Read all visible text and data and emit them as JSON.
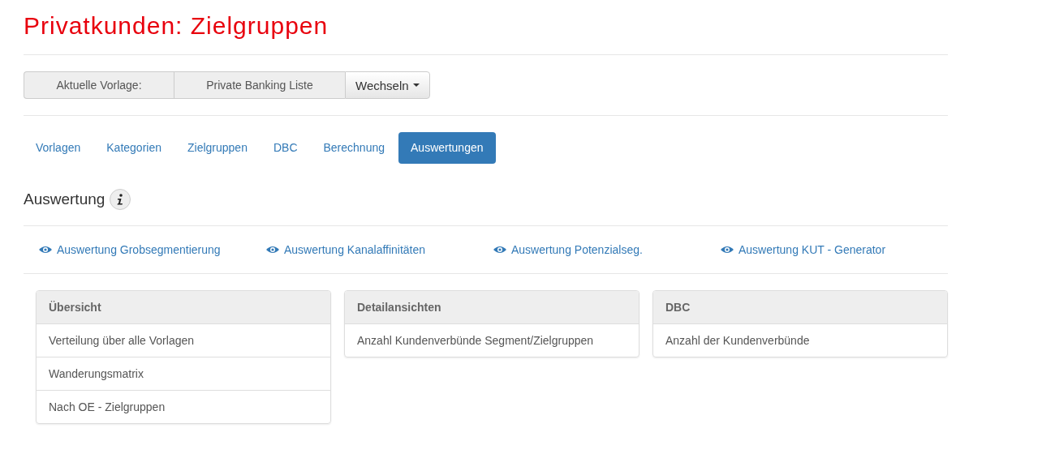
{
  "title": "Privatkunden: Zielgruppen",
  "template": {
    "label": "Aktuelle Vorlage:",
    "value": "Private Banking Liste",
    "button": "Wechseln"
  },
  "tabs": [
    {
      "label": "Vorlagen",
      "selected": false
    },
    {
      "label": "Kategorien",
      "selected": false
    },
    {
      "label": "Zielgruppen",
      "selected": false
    },
    {
      "label": "DBC",
      "selected": false
    },
    {
      "label": "Berechnung",
      "selected": false
    },
    {
      "label": "Auswertungen",
      "selected": true
    }
  ],
  "section": {
    "heading": "Auswertung"
  },
  "links": [
    "Auswertung Grobsegmentierung",
    "Auswertung Kanalaffinitäten",
    "Auswertung Potenzialseg.",
    "Auswertung KUT - Generator"
  ],
  "panels": [
    {
      "heading": "Übersicht",
      "items": [
        "Verteilung über alle Vorlagen",
        "Wanderungsmatrix",
        "Nach OE - Zielgruppen"
      ]
    },
    {
      "heading": "Detailansichten",
      "items": [
        "Anzahl Kundenverbünde Segment/Zielgruppen"
      ]
    },
    {
      "heading": "DBC",
      "items": [
        "Anzahl der Kundenverbünde"
      ]
    }
  ]
}
